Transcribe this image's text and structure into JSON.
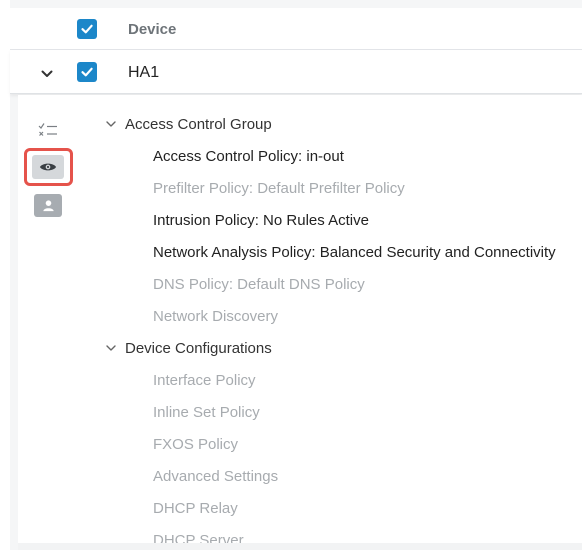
{
  "table_header": {
    "device_label": "Device"
  },
  "device_row": {
    "name": "HA1"
  },
  "groups": [
    {
      "title": "Access Control Group",
      "items": [
        {
          "label": "Access Control Policy: in-out",
          "active": true
        },
        {
          "label": "Prefilter Policy: Default Prefilter Policy",
          "active": false
        },
        {
          "label": "Intrusion Policy: No Rules Active",
          "active": true
        },
        {
          "label": "Network Analysis Policy: Balanced Security and Connectivity",
          "active": true
        },
        {
          "label": "DNS Policy: Default DNS Policy",
          "active": false
        },
        {
          "label": "Network Discovery",
          "active": false
        }
      ]
    },
    {
      "title": "Device Configurations",
      "items": [
        {
          "label": "Interface Policy",
          "active": false
        },
        {
          "label": "Inline Set Policy",
          "active": false
        },
        {
          "label": "FXOS Policy",
          "active": false
        },
        {
          "label": "Advanced Settings",
          "active": false
        },
        {
          "label": "DHCP Relay",
          "active": false
        },
        {
          "label": "DHCP Server",
          "active": false
        }
      ]
    }
  ],
  "colors": {
    "checkbox": "#1c87c9",
    "highlight": "#e5534b",
    "active_text": "#222222",
    "inactive_text": "#a7abaf"
  }
}
